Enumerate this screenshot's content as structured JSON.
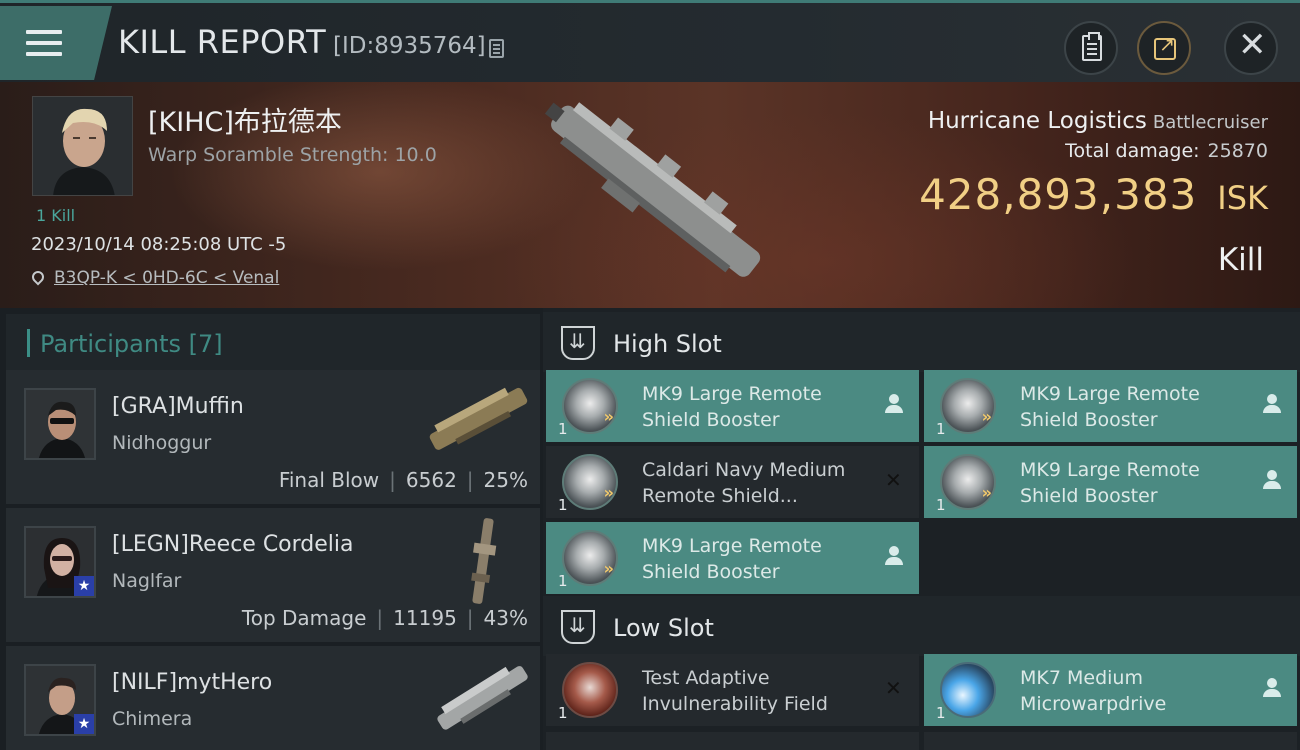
{
  "header": {
    "title": "KILL REPORT",
    "report_id": "[ID:8935764]",
    "icons": [
      "menu-icon",
      "copy-icon",
      "clipboard-icon",
      "share-icon",
      "close-icon"
    ]
  },
  "victim": {
    "name": "[KIHC]布拉德本",
    "scramble": "Warp Soramble Strength: 10.0",
    "kill_count": "1 Kill",
    "timestamp": "2023/10/14 08:25:08 UTC -5",
    "location": "B3QP-K < 0HD-6C < Venal",
    "ship": "Hurricane Logistics",
    "ship_class": "Battlecruiser",
    "damage_label": "Total damage:",
    "damage_value": "25870",
    "isk_value": "428,893,383",
    "isk_unit": "ISK",
    "result": "Kill"
  },
  "participants": {
    "title": "Participants [7]",
    "rows": [
      {
        "name": "[GRA]Muffin",
        "ship": "Nidhoggur",
        "role": "Final Blow",
        "damage": "6562",
        "percent": "25%",
        "star": false
      },
      {
        "name": "[LEGN]Reece Cordelia",
        "ship": "Naglfar",
        "role": "Top Damage",
        "damage": "11195",
        "percent": "43%",
        "star": true
      },
      {
        "name": "[NILF]mytHero",
        "ship": "Chimera",
        "role": "",
        "damage": "",
        "percent": "",
        "star": true
      }
    ]
  },
  "slots": {
    "high": {
      "title": "High Slot",
      "modules": [
        {
          "name": "MK9 Large Remote Shield Booster",
          "qty": "1",
          "state": "dropped"
        },
        {
          "name": "MK9 Large Remote Shield Booster",
          "qty": "1",
          "state": "dropped"
        },
        {
          "name": "Caldari Navy Medium Remote Shield...",
          "qty": "1",
          "state": "destroyed"
        },
        {
          "name": "MK9 Large Remote Shield Booster",
          "qty": "1",
          "state": "dropped"
        },
        {
          "name": "MK9 Large Remote Shield Booster",
          "qty": "1",
          "state": "dropped"
        }
      ]
    },
    "low": {
      "title": "Low Slot",
      "modules": [
        {
          "name": "Test Adaptive Invulnerability Field",
          "qty": "1",
          "state": "destroyed"
        },
        {
          "name": "MK7 Medium Microwarpdrive",
          "qty": "1",
          "state": "dropped"
        }
      ]
    }
  },
  "colors": {
    "accent_teal": "#4b8a82",
    "isk_gold": "#f1cf85",
    "banner_red": "#4a2a20"
  }
}
